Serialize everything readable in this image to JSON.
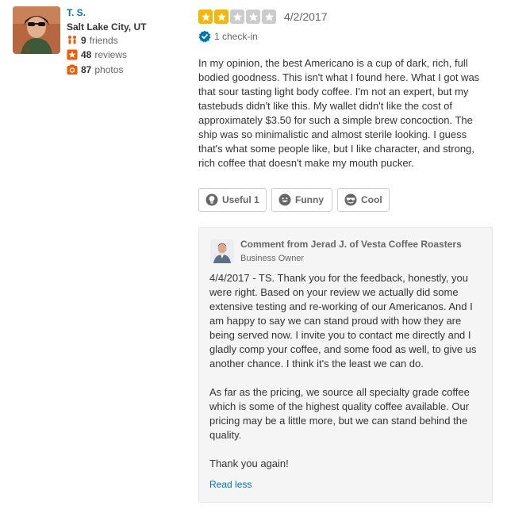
{
  "user": {
    "name": "T. S.",
    "location": "Salt Lake City, UT",
    "friends_count": "9",
    "friends_label": "friends",
    "reviews_count": "48",
    "reviews_label": "reviews",
    "photos_count": "87",
    "photos_label": "photos"
  },
  "review": {
    "rating": 2,
    "max_rating": 5,
    "date": "4/2/2017",
    "checkin": "1 check-in",
    "text": "In my opinion, the best Americano is a cup of dark, rich, full bodied goodness. This isn't what I found here. What I got was that sour tasting light body coffee. I'm not an expert, but my tastebuds didn't like this. My wallet didn't like the cost of approximately $3.50 for such a simple brew concoction. The ship was so minimalistic and almost sterile looking. I guess that's what some people like, but I like character, and strong, rich coffee that doesn't make my mouth pucker."
  },
  "votes": {
    "useful": "Useful 1",
    "funny": "Funny",
    "cool": "Cool"
  },
  "owner_comment": {
    "from": "Comment from Jerad J. of Vesta Coffee Roasters",
    "role": "Business Owner",
    "paragraphs": [
      "4/4/2017 - TS.  Thank you for the feedback, honestly, you were right.  Based on your review we actually did some extensive testing and re-working of our Americanos.  And I am happy to say we can stand proud with how they are being served now.  I invite you to contact me directly and I gladly comp your coffee, and some food as well, to give us another chance.  I think it's the least we can do.",
      "As far as the pricing, we source all specialty grade coffee which is some of the highest quality coffee available.  Our pricing may be a little more, but we can stand behind the quality.",
      "Thank you again!"
    ],
    "read_less": "Read less"
  },
  "colors": {
    "link": "#0073bb",
    "star_filled": "#f5b700",
    "star_empty": "#cccccc",
    "friends_icon": "#f15c00",
    "reviews_icon": "#f15c00",
    "photos_icon": "#f15c00",
    "checkin_badge": "#0073bb"
  },
  "icons": {
    "friends": "friends-icon",
    "reviews": "star-square-icon",
    "photos": "camera-icon",
    "checkin": "checkin-badge-icon",
    "useful": "lightbulb-icon",
    "funny": "smile-icon",
    "cool": "sunglasses-face-icon"
  }
}
